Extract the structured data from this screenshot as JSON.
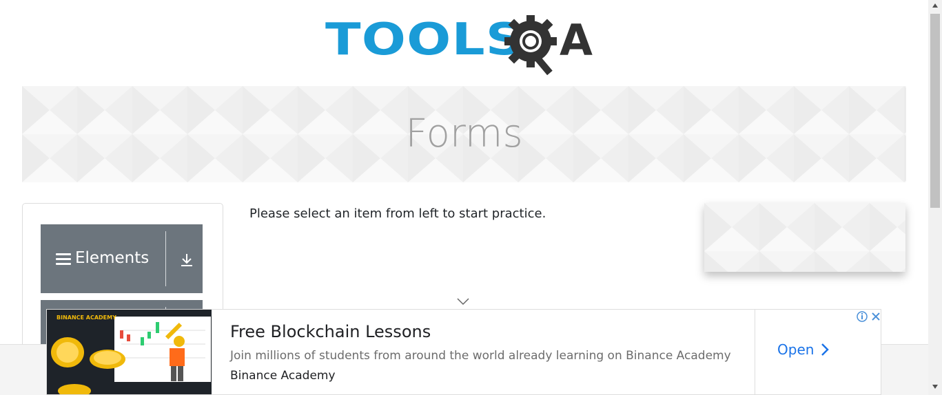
{
  "logo": {
    "text": "TOOLS",
    "suffix": "A",
    "brand_colors": {
      "blue": "#1a9bd7",
      "dark": "#333333"
    }
  },
  "banner": {
    "title": "Forms"
  },
  "sidebar": {
    "groups": [
      {
        "label": "Elements",
        "icon": "hamburger-icon",
        "toggle_icon": "download-arrow-icon"
      }
    ]
  },
  "main": {
    "instruction": "Please select an item from left to start practice."
  },
  "ad": {
    "brand": "BINANCE ACADEMY",
    "title": "Free Blockchain Lessons",
    "description": "Join millions of students from around the world already learning on Binance Academy",
    "advertiser": "Binance Academy",
    "cta": "Open",
    "colors": {
      "cta": "#1a73e8",
      "brand": "#f0b90b"
    }
  }
}
